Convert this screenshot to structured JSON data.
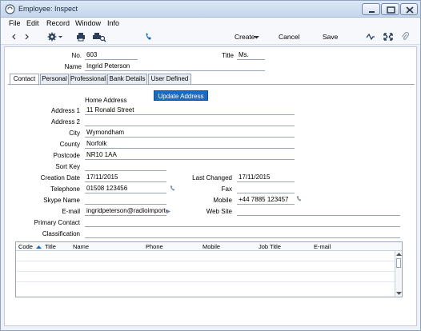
{
  "window": {
    "title": "Employee: Inspect"
  },
  "menu": [
    "File",
    "Edit",
    "Record",
    "Window",
    "Info"
  ],
  "toolbar": {
    "create_label": "Create",
    "cancel_label": "Cancel",
    "save_label": "Save"
  },
  "header": {
    "no_label": "No.",
    "no_value": "603",
    "title_label": "Title",
    "title_value": "Ms.",
    "name_label": "Name",
    "name_value": "Ingrid Peterson"
  },
  "tabs": [
    "Contact",
    "Personal",
    "Professional",
    "Bank Details",
    "User Defined"
  ],
  "contact": {
    "update_button": "Update Address",
    "home_address_label": "Home Address",
    "address1_label": "Address 1",
    "address1_value": "11 Ronald Street",
    "address2_label": "Address 2",
    "address2_value": "",
    "city_label": "City",
    "city_value": "Wymondham",
    "county_label": "County",
    "county_value": "Norfolk",
    "postcode_label": "Postcode",
    "postcode_value": "NR10 1AA",
    "sortkey_label": "Sort Key",
    "sortkey_value": "",
    "creation_label": "Creation Date",
    "creation_value": "17/11/2015",
    "lastchanged_label": "Last Changed",
    "lastchanged_value": "17/11/2015",
    "telephone_label": "Telephone",
    "telephone_value": "01508 123456",
    "fax_label": "Fax",
    "fax_value": "",
    "skype_label": "Skype Name",
    "skype_value": "",
    "mobile_label": "Mobile",
    "mobile_value": "+44 7885 123457",
    "email_label": "E-mail",
    "email_value": "ingridpeterson@radioimporter",
    "website_label": "Web Site",
    "website_value": "",
    "primary_label": "Primary Contact",
    "primary_value": "",
    "classification_label": "Classification",
    "classification_value": ""
  },
  "grid": {
    "columns": [
      "Code",
      "Title",
      "Name",
      "Phone",
      "Mobile",
      "Job Title",
      "E-mail"
    ],
    "rows": 4
  },
  "colors": {
    "accent": "#1a6bc4",
    "titlebar": "#c5d6ec"
  }
}
